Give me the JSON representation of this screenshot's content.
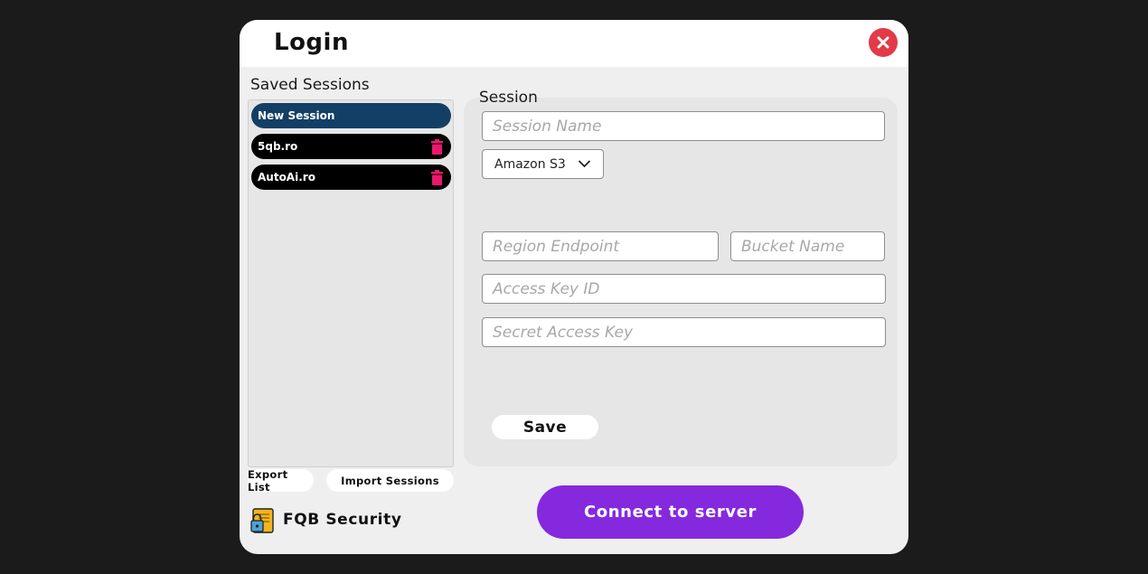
{
  "dialog": {
    "title": "Login",
    "close_icon": "close-icon"
  },
  "sidebar": {
    "title": "Saved Sessions",
    "items": [
      {
        "label": "New Session",
        "active": true
      },
      {
        "label": "5qb.ro",
        "active": false,
        "icon": "trash-icon"
      },
      {
        "label": "AutoAi.ro",
        "active": false,
        "icon": "trash-icon"
      }
    ],
    "export_label": "Export List",
    "import_label": "Import Sessions"
  },
  "brand": {
    "name": "FQB Security",
    "icon": "lock-logo-icon"
  },
  "session": {
    "label": "Session",
    "name_placeholder": "Session Name",
    "provider": {
      "selected": "Amazon S3"
    },
    "region_placeholder": "Region Endpoint",
    "bucket_placeholder": "Bucket Name",
    "access_key_placeholder": "Access Key ID",
    "secret_key_placeholder": "Secret Access Key",
    "save_label": "Save"
  },
  "connect_label": "Connect to server",
  "colors": {
    "background": "#1b1b1b",
    "dialog": "#efefef",
    "active_item": "#133f66",
    "connect": "#8529de",
    "close": "#e23a48",
    "trash": "#e8196a"
  }
}
